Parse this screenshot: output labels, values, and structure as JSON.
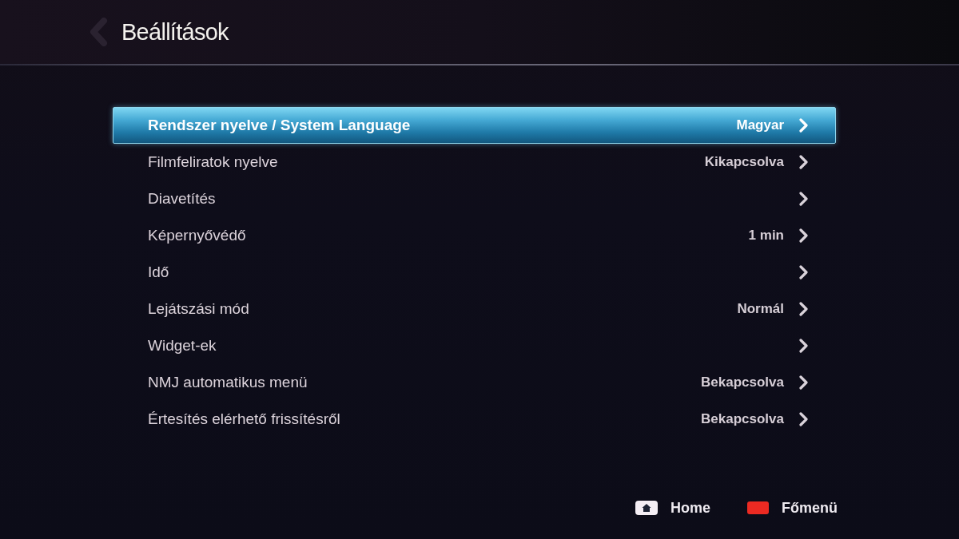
{
  "header": {
    "title": "Beállítások"
  },
  "settings": [
    {
      "label": "Rendszer nyelve / System Language",
      "value": "Magyar",
      "selected": true
    },
    {
      "label": "Filmfeliratok nyelve",
      "value": "Kikapcsolva",
      "selected": false
    },
    {
      "label": "Diavetítés",
      "selected": false
    },
    {
      "label": "Képernyővédő",
      "value": "1 min",
      "selected": false
    },
    {
      "label": "Idő",
      "selected": false
    },
    {
      "label": "Lejátszási mód",
      "value": "Normál",
      "selected": false
    },
    {
      "label": "Widget-ek",
      "selected": false
    },
    {
      "label": "NMJ automatikus menü",
      "value": "Bekapcsolva",
      "selected": false
    },
    {
      "label": "Értesítés elérhető frissítésről",
      "value": "Bekapcsolva",
      "selected": false
    }
  ],
  "footer": {
    "hints": [
      {
        "kind": "home",
        "label": "Home"
      },
      {
        "kind": "color-key",
        "label": "Főmenü"
      }
    ]
  }
}
